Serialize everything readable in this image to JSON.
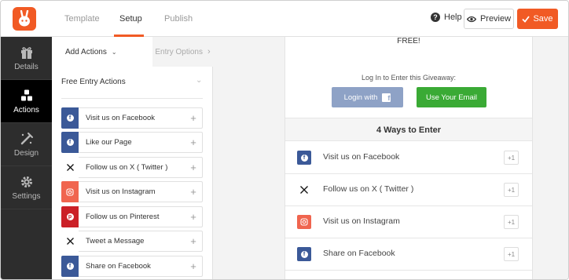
{
  "header": {
    "logo_icon": "rabbit-logo-icon",
    "tabs": [
      {
        "label": "Template",
        "active": false
      },
      {
        "label": "Setup",
        "active": true
      },
      {
        "label": "Publish",
        "active": false
      }
    ],
    "help_label": "Help",
    "preview_label": "Preview",
    "save_label": "Save",
    "accent_color": "#f15a24"
  },
  "leftnav": {
    "items": [
      {
        "label": "Details",
        "icon": "gift-icon",
        "active": false
      },
      {
        "label": "Actions",
        "icon": "actions-icon",
        "active": true
      },
      {
        "label": "Design",
        "icon": "design-icon",
        "active": false
      },
      {
        "label": "Settings",
        "icon": "gear-icon",
        "active": false
      }
    ]
  },
  "panel": {
    "subtabs": [
      {
        "label": "Add Actions",
        "icon": "chevron-down-icon"
      },
      {
        "label": "Entry Options",
        "icon": "chevron-right-icon"
      }
    ],
    "section_title": "Free Entry Actions",
    "actions": [
      {
        "label": "Visit us on Facebook",
        "icon": "facebook-icon",
        "color": "#3b5998"
      },
      {
        "label": "Like our Page",
        "icon": "facebook-icon",
        "color": "#3b5998"
      },
      {
        "label": "Follow us on X ( Twitter )",
        "icon": "x-icon",
        "color": "#ffffff"
      },
      {
        "label": "Visit us on Instagram",
        "icon": "instagram-icon",
        "color": "#f0654f"
      },
      {
        "label": "Follow us on Pinterest",
        "icon": "pinterest-icon",
        "color": "#cb2027"
      },
      {
        "label": "Tweet a Message",
        "icon": "x-icon",
        "color": "#ffffff"
      },
      {
        "label": "Share on Facebook",
        "icon": "facebook-icon",
        "color": "#3b5998"
      }
    ]
  },
  "widget": {
    "free_text": "FREE!",
    "login_text": "Log In to Enter this Giveaway:",
    "login_facebook_label": "Login with",
    "login_email_label": "Use Your Email",
    "ways_title": "4 Ways to Enter",
    "entries": [
      {
        "label": "Visit us on Facebook",
        "icon": "facebook-icon",
        "points": "+1"
      },
      {
        "label": "Follow us on X ( Twitter )",
        "icon": "x-icon",
        "points": "+1"
      },
      {
        "label": "Visit us on Instagram",
        "icon": "instagram-icon",
        "points": "+1"
      },
      {
        "label": "Share on Facebook",
        "icon": "facebook-icon",
        "points": "+1"
      }
    ]
  }
}
